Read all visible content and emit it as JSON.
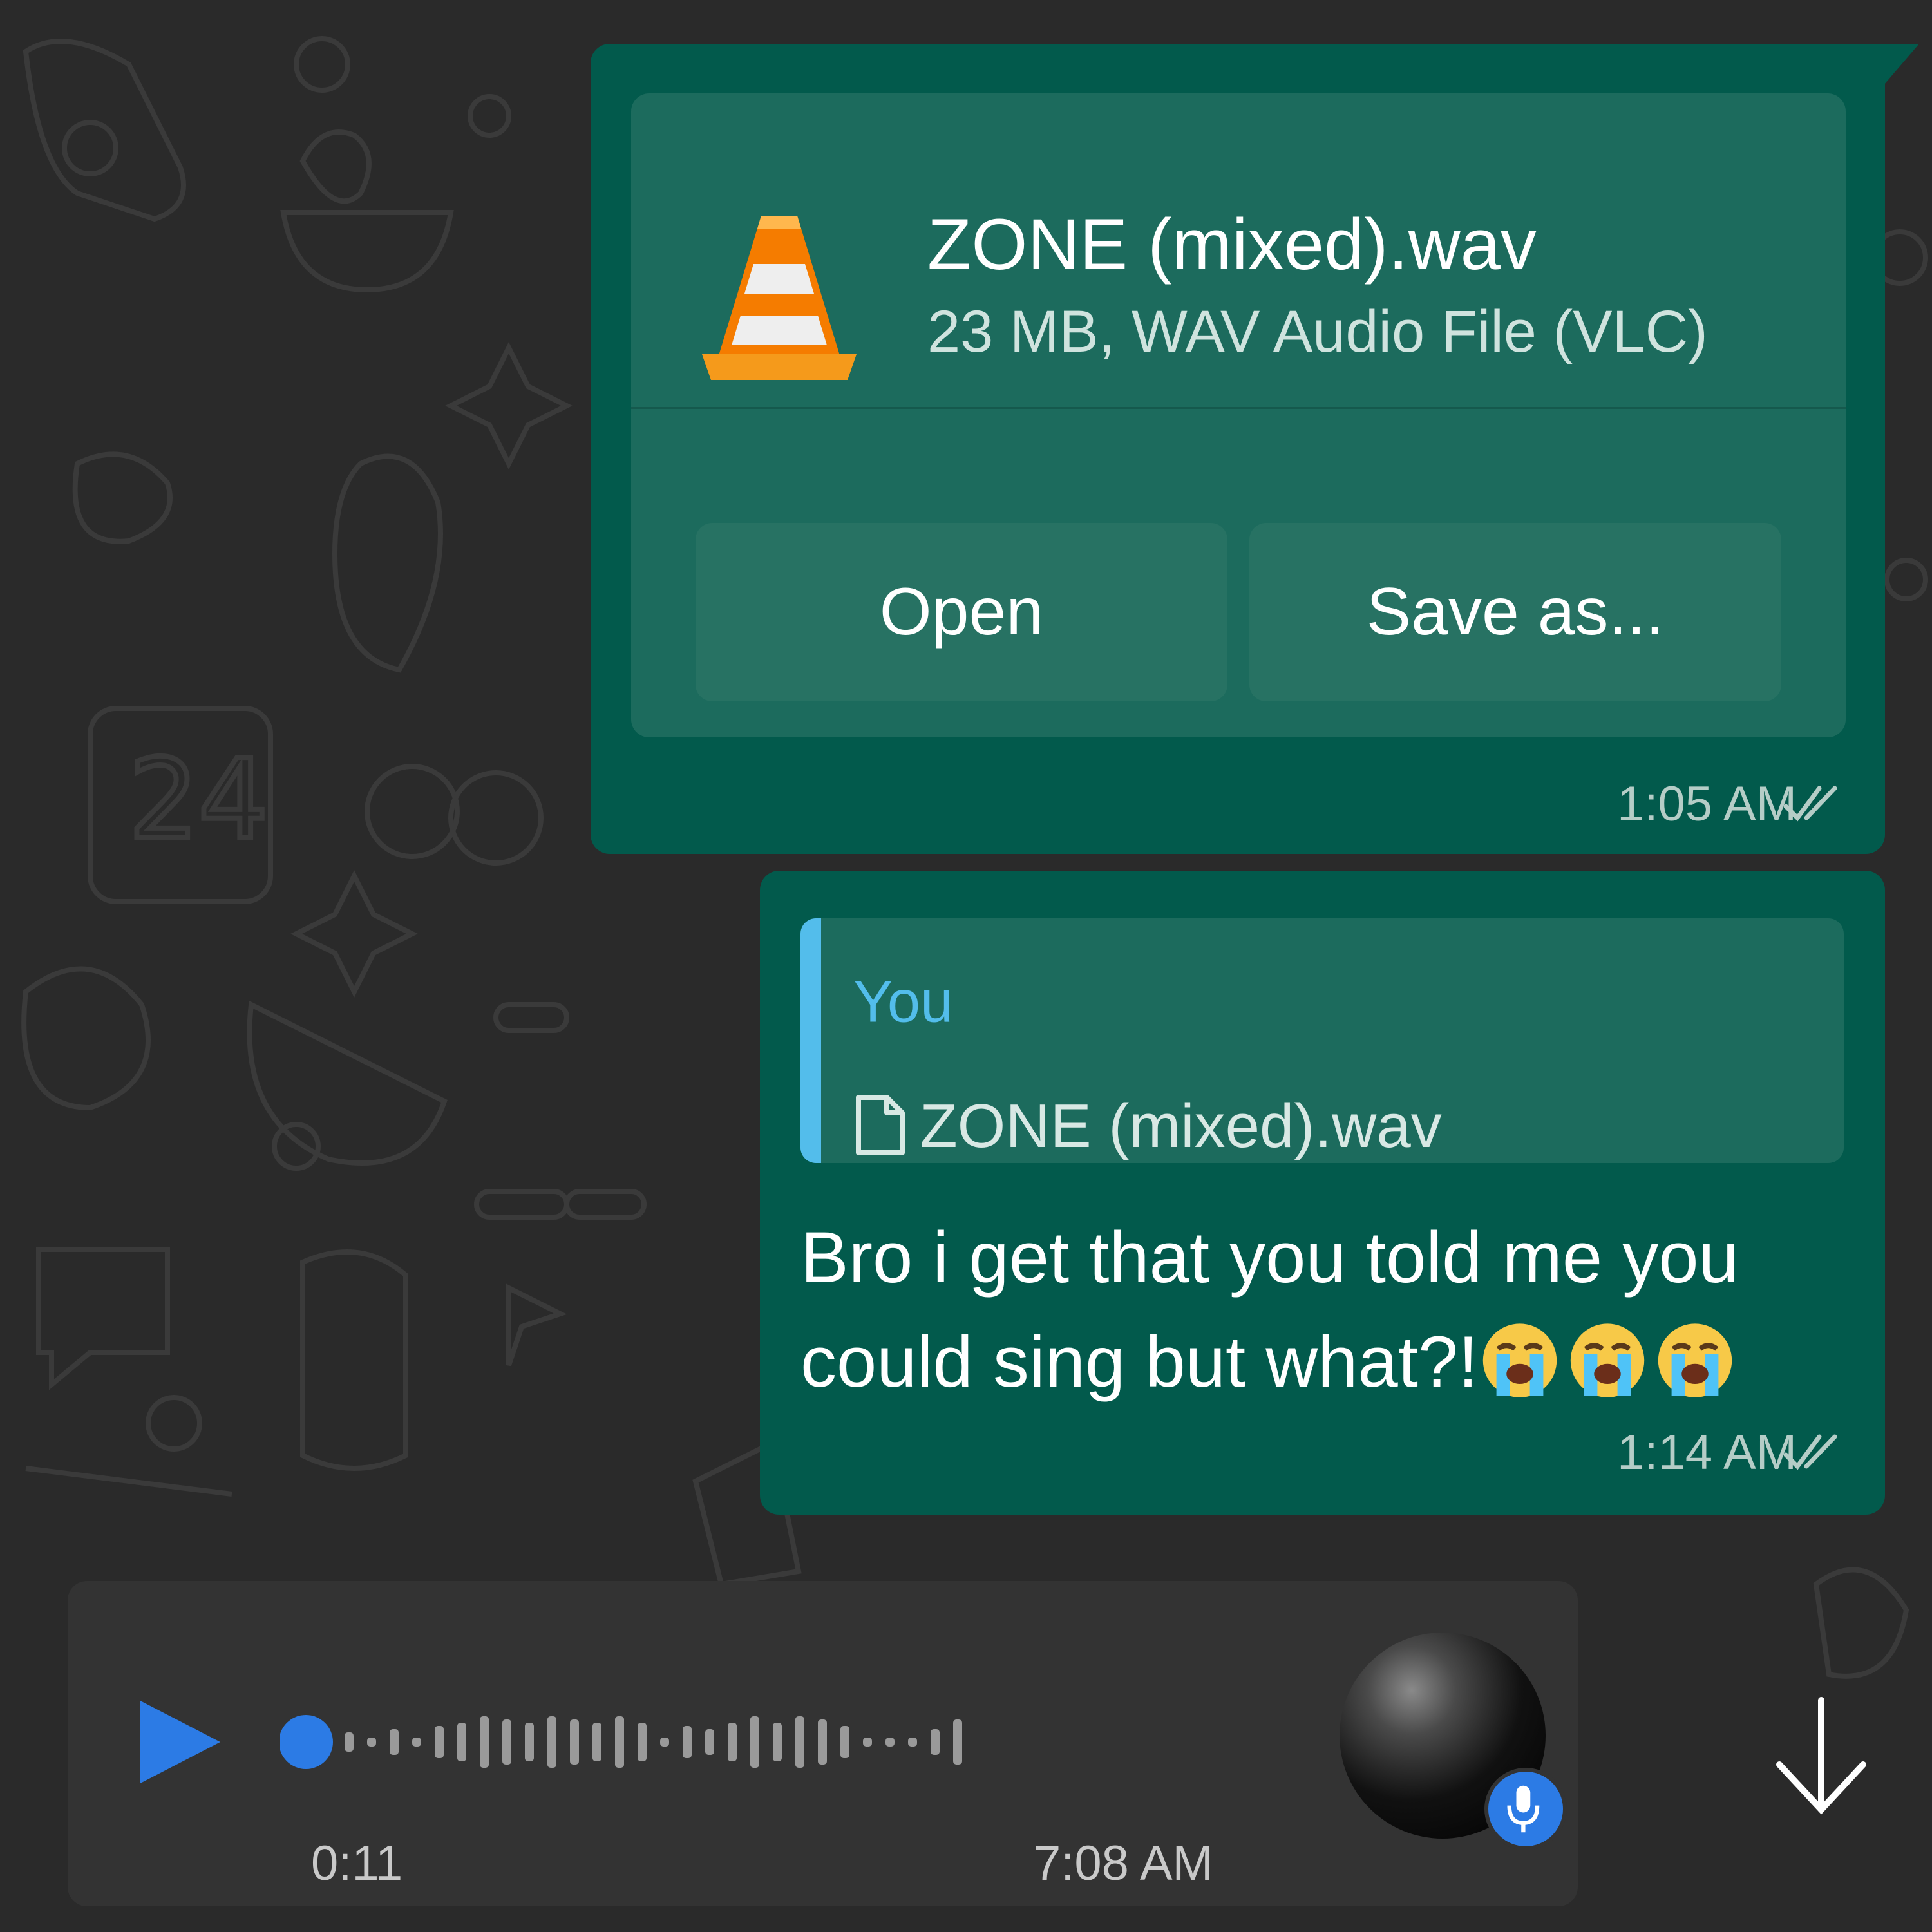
{
  "colors": {
    "outgoing_bubble": "#025a4c",
    "file_card": "#1c6b5d",
    "quote_accent": "#53bdeb",
    "accent_blue": "#2c7be5",
    "chat_background": "#2a2a2a"
  },
  "file_message": {
    "icon": "vlc-cone-icon",
    "file_name": "ZONE (mixed).wav",
    "file_meta": "23 MB, WAV Audio File (VLC)",
    "open_label": "Open",
    "save_label": "Save as...",
    "time": "1:05  AM",
    "status_icon": "double-check-icon"
  },
  "reply_message": {
    "quoted_author": "You",
    "quoted_icon": "document-icon",
    "quoted_file": "ZONE (mixed).wav",
    "text": "Bro i get that you told me you could sing but what?!",
    "emojis": [
      "loudly-crying-face",
      "loudly-crying-face",
      "loudly-crying-face"
    ],
    "time": "1:14  AM",
    "status_icon": "double-check-icon"
  },
  "voice_message": {
    "play_icon": "play-icon",
    "progress": 0.0,
    "duration": "0:11",
    "time": "7:08  AM",
    "badge_icon": "microphone-icon"
  },
  "scroll_button": {
    "icon": "arrow-down-icon"
  }
}
